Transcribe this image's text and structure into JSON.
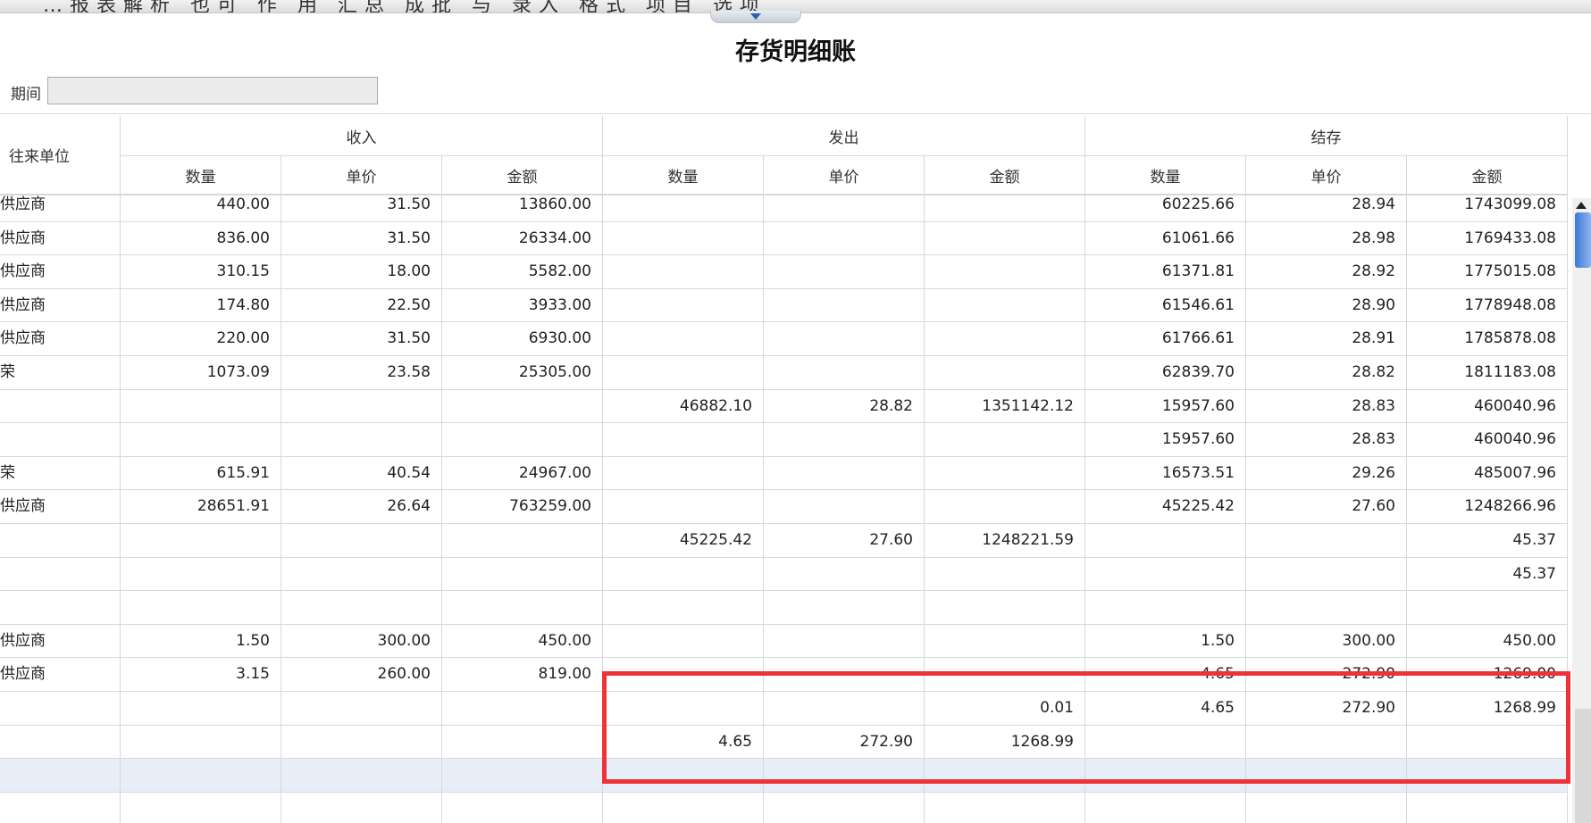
{
  "topbar": {
    "clipped_text": "…报表解析 也可 作 用 汇总 成批 与 录入 格式 项目 选项"
  },
  "report": {
    "title": "存货明细账"
  },
  "filter": {
    "period_label": "期间",
    "period_value": ""
  },
  "table": {
    "partner_header": "往来单位",
    "groups": [
      "收入",
      "发出",
      "结存"
    ],
    "subheaders": [
      "数量",
      "单价",
      "金额",
      "数量",
      "单价",
      "金额",
      "数量",
      "单价",
      "金额"
    ],
    "rows": [
      [
        "供应商",
        "440.00",
        "31.50",
        "13860.00",
        "",
        "",
        "",
        "60225.66",
        "28.94",
        "1743099.08"
      ],
      [
        "供应商",
        "836.00",
        "31.50",
        "26334.00",
        "",
        "",
        "",
        "61061.66",
        "28.98",
        "1769433.08"
      ],
      [
        "供应商",
        "310.15",
        "18.00",
        "5582.00",
        "",
        "",
        "",
        "61371.81",
        "28.92",
        "1775015.08"
      ],
      [
        "供应商",
        "174.80",
        "22.50",
        "3933.00",
        "",
        "",
        "",
        "61546.61",
        "28.90",
        "1778948.08"
      ],
      [
        "供应商",
        "220.00",
        "31.50",
        "6930.00",
        "",
        "",
        "",
        "61766.61",
        "28.91",
        "1785878.08"
      ],
      [
        "荣",
        "1073.09",
        "23.58",
        "25305.00",
        "",
        "",
        "",
        "62839.70",
        "28.82",
        "1811183.08"
      ],
      [
        "",
        "",
        "",
        "",
        "46882.10",
        "28.82",
        "1351142.12",
        "15957.60",
        "28.83",
        "460040.96"
      ],
      [
        "",
        "",
        "",
        "",
        "",
        "",
        "",
        "15957.60",
        "28.83",
        "460040.96"
      ],
      [
        "荣",
        "615.91",
        "40.54",
        "24967.00",
        "",
        "",
        "",
        "16573.51",
        "29.26",
        "485007.96"
      ],
      [
        "供应商",
        "28651.91",
        "26.64",
        "763259.00",
        "",
        "",
        "",
        "45225.42",
        "27.60",
        "1248266.96"
      ],
      [
        "",
        "",
        "",
        "",
        "45225.42",
        "27.60",
        "1248221.59",
        "",
        "",
        "45.37"
      ],
      [
        "",
        "",
        "",
        "",
        "",
        "",
        "",
        "",
        "",
        "45.37"
      ],
      [
        "",
        "",
        "",
        "",
        "",
        "",
        "",
        "",
        "",
        ""
      ],
      [
        "供应商",
        "1.50",
        "300.00",
        "450.00",
        "",
        "",
        "",
        "1.50",
        "300.00",
        "450.00"
      ],
      [
        "供应商",
        "3.15",
        "260.00",
        "819.00",
        "",
        "",
        "",
        "4.65",
        "272.90",
        "1269.00"
      ],
      [
        "",
        "",
        "",
        "",
        "",
        "",
        "0.01",
        "4.65",
        "272.90",
        "1268.99"
      ],
      [
        "",
        "",
        "",
        "",
        "4.65",
        "272.90",
        "1268.99",
        "",
        "",
        ""
      ],
      [
        "",
        "",
        "",
        "",
        "",
        "",
        "",
        "",
        "",
        ""
      ],
      [
        "",
        "",
        "",
        "",
        "",
        "",
        "",
        "",
        "",
        ""
      ],
      [
        "",
        "",
        "",
        "",
        "",
        "",
        "",
        "",
        "",
        ""
      ]
    ],
    "highlighted_row_index": 17
  },
  "colors": {
    "highlight_box": "#ee3338",
    "selected_row": "#e8eef7"
  }
}
